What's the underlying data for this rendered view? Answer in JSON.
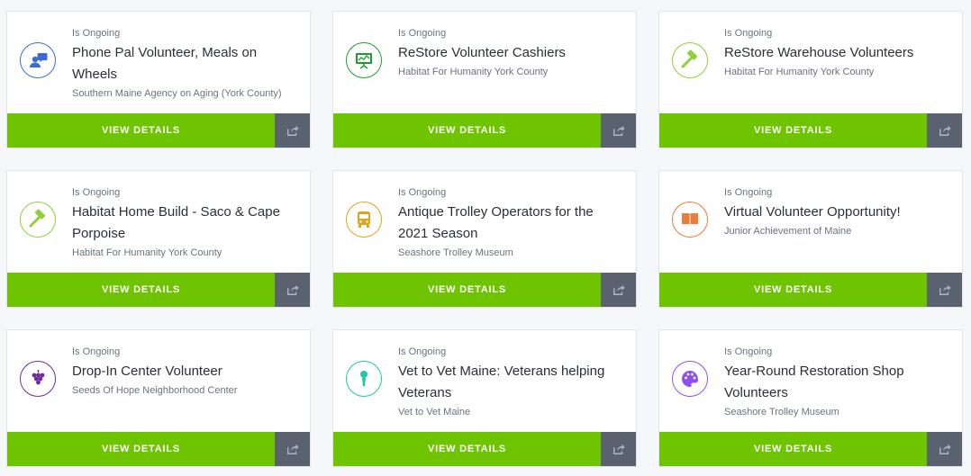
{
  "cards": [
    {
      "status": "Is Ongoing",
      "title": "Phone Pal Volunteer, Meals on Wheels",
      "org": "Southern Maine Agency on Aging (York County)",
      "icon": "phone-chat-icon",
      "color": "#3c6ad6",
      "button": "VIEW DETAILS"
    },
    {
      "status": "Is Ongoing",
      "title": "ReStore Volunteer Cashiers",
      "org": "Habitat For Humanity York County",
      "icon": "presentation-icon",
      "color": "#1f9a2f",
      "button": "VIEW DETAILS"
    },
    {
      "status": "Is Ongoing",
      "title": "ReStore Warehouse Volunteers",
      "org": "Habitat For Humanity York County",
      "icon": "hammer-icon",
      "color": "#8fd03a",
      "button": "VIEW DETAILS"
    },
    {
      "status": "Is Ongoing",
      "title": "Habitat Home Build - Saco & Cape Porpoise",
      "org": "Habitat For Humanity York County",
      "icon": "hammer-icon",
      "color": "#8fd03a",
      "button": "VIEW DETAILS"
    },
    {
      "status": "Is Ongoing",
      "title": "Antique Trolley Operators for the 2021 Season",
      "org": "Seashore Trolley Museum",
      "icon": "bus-icon",
      "color": "#e0a419",
      "button": "VIEW DETAILS"
    },
    {
      "status": "Is Ongoing",
      "title": "Virtual Volunteer Opportunity!",
      "org": "Junior Achievement of Maine",
      "icon": "book-icon",
      "color": "#ec7c3a",
      "button": "VIEW DETAILS"
    },
    {
      "status": "Is Ongoing",
      "title": "Drop-In Center Volunteer",
      "org": "Seeds Of Hope Neighborhood Center",
      "icon": "grapes-icon",
      "color": "#6f2a9e",
      "button": "VIEW DETAILS"
    },
    {
      "status": "Is Ongoing",
      "title": "Vet to Vet Maine: Veterans helping Veterans",
      "org": "Vet to Vet Maine",
      "icon": "microphone-icon",
      "color": "#1fc7a6",
      "button": "VIEW DETAILS"
    },
    {
      "status": "Is Ongoing",
      "title": "Year-Round Restoration Shop Volunteers",
      "org": "Seashore Trolley Museum",
      "icon": "palette-icon",
      "color": "#8f4ff0",
      "button": "VIEW DETAILS"
    }
  ]
}
